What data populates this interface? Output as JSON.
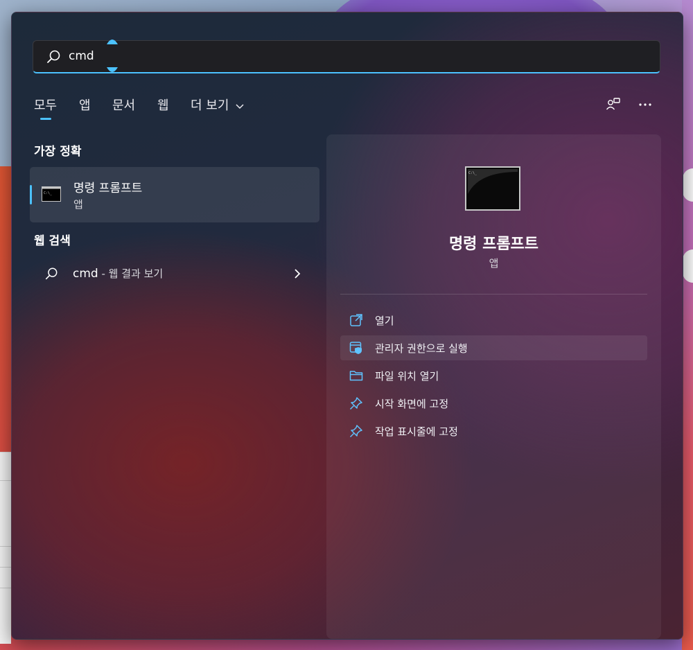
{
  "search": {
    "query": "cmd"
  },
  "tabs": [
    {
      "label": "모두"
    },
    {
      "label": "앱"
    },
    {
      "label": "문서"
    },
    {
      "label": "웹"
    },
    {
      "label": "더 보기"
    }
  ],
  "sections": {
    "best_match": "가장 정확",
    "web_search": "웹 검색"
  },
  "best_match": {
    "name": "명령 프롬프트",
    "kind": "앱"
  },
  "web_result": {
    "query": "cmd",
    "suffix": " - 웹 결과 보기"
  },
  "detail": {
    "title": "명령 프롬프트",
    "kind": "앱",
    "actions": [
      {
        "label": "열기",
        "icon": "open-external-icon"
      },
      {
        "label": "관리자 권한으로 실행",
        "icon": "shield-run-icon"
      },
      {
        "label": "파일 위치 열기",
        "icon": "folder-icon"
      },
      {
        "label": "시작 화면에 고정",
        "icon": "pin-icon"
      },
      {
        "label": "작업 표시줄에 고정",
        "icon": "pin-icon"
      }
    ]
  },
  "colors": {
    "accent": "#4cc2ff"
  }
}
